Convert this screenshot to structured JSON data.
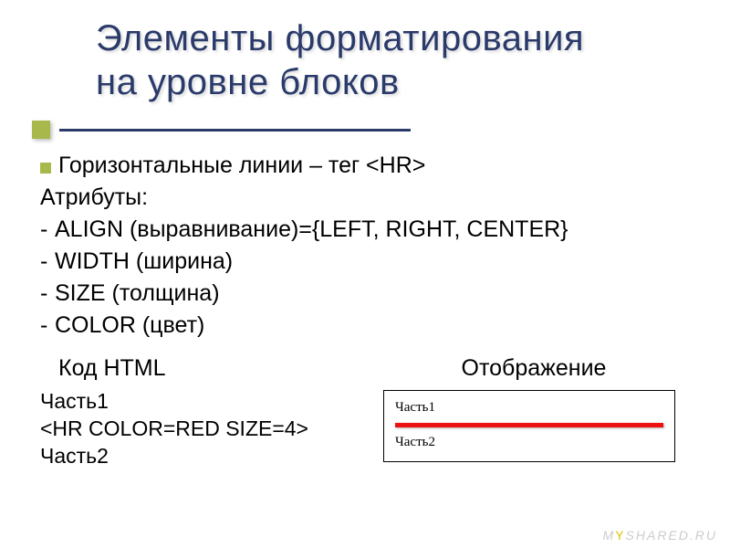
{
  "title_line1": "Элементы форматирования",
  "title_line2": "на уровне блоков",
  "bullet": "Горизонтальные линии – тег <HR>",
  "attributes_label": "Атрибуты:",
  "dashes": [
    "ALIGN (выравнивание)={LEFT, RIGHT, CENTER}",
    "WIDTH (ширина)",
    "SIZE (толщина)",
    "COLOR (цвет)"
  ],
  "columns": {
    "left_head": "Код HTML",
    "right_head": "Отображение"
  },
  "code_lines": [
    "Часть1",
    "<HR COLOR=RED SIZE=4>",
    "Часть2"
  ],
  "render": {
    "top": "Часть1",
    "bottom": "Часть2"
  },
  "watermark": {
    "prefix": "M",
    "y": "Y",
    "suffix": "SHARED.RU"
  }
}
